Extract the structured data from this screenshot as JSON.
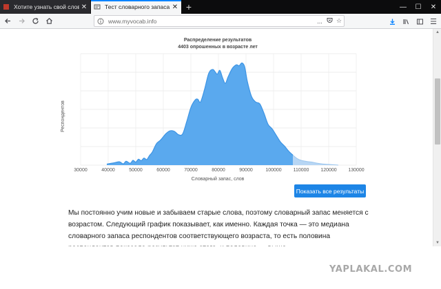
{
  "browser": {
    "tabs": [
      {
        "title": "Хотите узнать свой словарный",
        "active": false
      },
      {
        "title": "Тест словарного запаса",
        "active": true
      }
    ],
    "new_tab_label": "+",
    "url": "www.myvocab.info",
    "url_actions": [
      "...",
      "pocket",
      "star"
    ],
    "colors": {
      "accent": "#0a84ff",
      "tab_bar": "#0c0c0d",
      "toolbar": "#f5f6f7"
    }
  },
  "chart": {
    "title_line1": "Распределение результатов",
    "title_line2": "4403 опрошенных в возрасте      лет",
    "ylabel": "Респондентов",
    "xlabel": "Словарный запас, слов"
  },
  "chart_data": {
    "type": "area",
    "title": "Распределение результатов",
    "subtitle": "4403 опрошенных в возрасте      лет",
    "xlabel": "Словарный запас, слов",
    "ylabel": "Респондентов",
    "xlim": [
      30000,
      130000
    ],
    "x_ticks": [
      30000,
      40000,
      50000,
      60000,
      70000,
      80000,
      90000,
      100000,
      110000,
      120000,
      130000
    ],
    "grid": true,
    "highlight_until_x": 107000,
    "colors": {
      "main": "#5aa9ee",
      "main_line": "#3d94e4",
      "tail": "#b7d6f4"
    },
    "points": [
      [
        39500,
        0.6
      ],
      [
        42000,
        1.2
      ],
      [
        44000,
        1.8
      ],
      [
        45500,
        0.7
      ],
      [
        46500,
        2.1
      ],
      [
        48000,
        1.0
      ],
      [
        49000,
        2.6
      ],
      [
        50000,
        1.6
      ],
      [
        51000,
        3.2
      ],
      [
        52000,
        2.4
      ],
      [
        53000,
        3.8
      ],
      [
        54000,
        3.0
      ],
      [
        55000,
        5.2
      ],
      [
        56000,
        7.0
      ],
      [
        57500,
        11.5
      ],
      [
        59000,
        13.5
      ],
      [
        61000,
        17.0
      ],
      [
        62500,
        18.5
      ],
      [
        64000,
        18.2
      ],
      [
        65500,
        16.4
      ],
      [
        67000,
        16.8
      ],
      [
        68500,
        23.5
      ],
      [
        70000,
        31.0
      ],
      [
        71500,
        35.0
      ],
      [
        72500,
        35.5
      ],
      [
        73500,
        34.0
      ],
      [
        75000,
        41.0
      ],
      [
        76500,
        49.5
      ],
      [
        78000,
        51.5
      ],
      [
        79500,
        49.0
      ],
      [
        80500,
        51.0
      ],
      [
        81500,
        47.0
      ],
      [
        82500,
        44.0
      ],
      [
        83500,
        47.5
      ],
      [
        85000,
        52.0
      ],
      [
        86500,
        54.0
      ],
      [
        87500,
        53.5
      ],
      [
        88500,
        55.0
      ],
      [
        89500,
        53.0
      ],
      [
        90500,
        45.0
      ],
      [
        92000,
        37.0
      ],
      [
        93500,
        34.0
      ],
      [
        95000,
        33.0
      ],
      [
        96500,
        28.0
      ],
      [
        98000,
        22.0
      ],
      [
        99500,
        19.5
      ],
      [
        101000,
        16.0
      ],
      [
        102500,
        12.5
      ],
      [
        104000,
        10.2
      ],
      [
        105500,
        7.5
      ],
      [
        107000,
        5.4
      ],
      [
        108500,
        3.6
      ],
      [
        110000,
        2.6
      ],
      [
        112000,
        2.0
      ],
      [
        114000,
        1.6
      ],
      [
        116000,
        1.0
      ],
      [
        118000,
        0.6
      ],
      [
        120000,
        0.4
      ],
      [
        122000,
        0.2
      ],
      [
        123500,
        0.0
      ]
    ],
    "ylim": [
      0,
      60
    ]
  },
  "button": {
    "label": "Показать все результаты"
  },
  "paragraph": {
    "text": "Мы постоянно учим новые и забываем старые слова, поэтому словарный запас меняется с возрастом. Следующий график показывает, как именно. Каждая точка — это медиана словарного запаса респондентов соответствующего возраста, то есть половина респондентов показала результат ниже этого, и половина — выше."
  },
  "watermark": "YAPLAKAL.COM"
}
